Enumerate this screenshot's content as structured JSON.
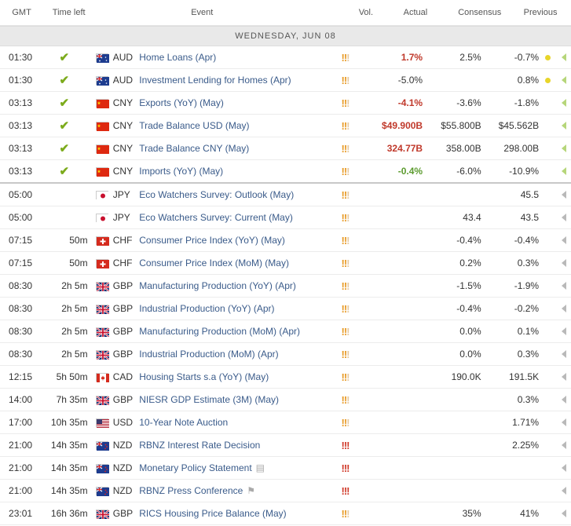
{
  "columns": {
    "gmt": "GMT",
    "time_left": "Time left",
    "event": "Event",
    "vol": "Vol.",
    "actual": "Actual",
    "consensus": "Consensus",
    "previous": "Previous"
  },
  "day_label": "WEDNESDAY, JUN 08",
  "colors": {
    "actual_negative": "#c0392b",
    "actual_positive": "#5c9b2f",
    "event_link": "#3a5b8a",
    "volatility": "#e89a25",
    "volatility_high": "#d03a2a",
    "check": "#7cab1c"
  },
  "rows": [
    {
      "gmt": "01:30",
      "time_left": "",
      "done": true,
      "flag": "au",
      "currency": "AUD",
      "event": "Home Loans (Apr)",
      "event_icon": "",
      "vol": 2,
      "actual": "1.7%",
      "actual_color": "red",
      "consensus": "2.5%",
      "previous": "-0.7%",
      "dot": true,
      "arrow": "green"
    },
    {
      "gmt": "01:30",
      "time_left": "",
      "done": true,
      "flag": "au",
      "currency": "AUD",
      "event": "Investment Lending for Homes (Apr)",
      "event_icon": "",
      "vol": 2,
      "actual": "-5.0%",
      "actual_color": "plain",
      "consensus": "",
      "previous": "0.8%",
      "dot": true,
      "arrow": "green"
    },
    {
      "gmt": "03:13",
      "time_left": "",
      "done": true,
      "flag": "cn",
      "currency": "CNY",
      "event": "Exports (YoY) (May)",
      "event_icon": "",
      "vol": 2,
      "actual": "-4.1%",
      "actual_color": "red",
      "consensus": "-3.6%",
      "previous": "-1.8%",
      "dot": false,
      "arrow": "green"
    },
    {
      "gmt": "03:13",
      "time_left": "",
      "done": true,
      "flag": "cn",
      "currency": "CNY",
      "event": "Trade Balance USD (May)",
      "event_icon": "",
      "vol": 2,
      "actual": "$49.900B",
      "actual_color": "red",
      "consensus": "$55.800B",
      "previous": "$45.562B",
      "dot": false,
      "arrow": "green"
    },
    {
      "gmt": "03:13",
      "time_left": "",
      "done": true,
      "flag": "cn",
      "currency": "CNY",
      "event": "Trade Balance CNY (May)",
      "event_icon": "",
      "vol": 2,
      "actual": "324.77B",
      "actual_color": "red",
      "consensus": "358.00B",
      "previous": "298.00B",
      "dot": false,
      "arrow": "green"
    },
    {
      "gmt": "03:13",
      "time_left": "",
      "done": true,
      "flag": "cn",
      "currency": "CNY",
      "event": "Imports (YoY) (May)",
      "event_icon": "",
      "vol": 2,
      "actual": "-0.4%",
      "actual_color": "green",
      "consensus": "-6.0%",
      "previous": "-10.9%",
      "dot": false,
      "arrow": "green",
      "sep": true
    },
    {
      "gmt": "05:00",
      "time_left": "",
      "done": false,
      "flag": "jp",
      "currency": "JPY",
      "event": "Eco Watchers Survey: Outlook (May)",
      "event_icon": "",
      "vol": 2,
      "actual": "",
      "actual_color": "plain",
      "consensus": "",
      "previous": "45.5",
      "dot": false,
      "arrow": "gray"
    },
    {
      "gmt": "05:00",
      "time_left": "",
      "done": false,
      "flag": "jp",
      "currency": "JPY",
      "event": "Eco Watchers Survey: Current (May)",
      "event_icon": "",
      "vol": 2,
      "actual": "",
      "actual_color": "plain",
      "consensus": "43.4",
      "previous": "43.5",
      "dot": false,
      "arrow": "gray"
    },
    {
      "gmt": "07:15",
      "time_left": "50m",
      "done": false,
      "flag": "ch",
      "currency": "CHF",
      "event": "Consumer Price Index (YoY) (May)",
      "event_icon": "",
      "vol": 2,
      "actual": "",
      "actual_color": "plain",
      "consensus": "-0.4%",
      "previous": "-0.4%",
      "dot": false,
      "arrow": "gray"
    },
    {
      "gmt": "07:15",
      "time_left": "50m",
      "done": false,
      "flag": "ch",
      "currency": "CHF",
      "event": "Consumer Price Index (MoM) (May)",
      "event_icon": "",
      "vol": 2,
      "actual": "",
      "actual_color": "plain",
      "consensus": "0.2%",
      "previous": "0.3%",
      "dot": false,
      "arrow": "gray"
    },
    {
      "gmt": "08:30",
      "time_left": "2h 5m",
      "done": false,
      "flag": "gb",
      "currency": "GBP",
      "event": "Manufacturing Production (YoY) (Apr)",
      "event_icon": "",
      "vol": 2,
      "actual": "",
      "actual_color": "plain",
      "consensus": "-1.5%",
      "previous": "-1.9%",
      "dot": false,
      "arrow": "gray"
    },
    {
      "gmt": "08:30",
      "time_left": "2h 5m",
      "done": false,
      "flag": "gb",
      "currency": "GBP",
      "event": "Industrial Production (YoY) (Apr)",
      "event_icon": "",
      "vol": 2,
      "actual": "",
      "actual_color": "plain",
      "consensus": "-0.4%",
      "previous": "-0.2%",
      "dot": false,
      "arrow": "gray"
    },
    {
      "gmt": "08:30",
      "time_left": "2h 5m",
      "done": false,
      "flag": "gb",
      "currency": "GBP",
      "event": "Manufacturing Production (MoM) (Apr)",
      "event_icon": "",
      "vol": 2,
      "actual": "",
      "actual_color": "plain",
      "consensus": "0.0%",
      "previous": "0.1%",
      "dot": false,
      "arrow": "gray"
    },
    {
      "gmt": "08:30",
      "time_left": "2h 5m",
      "done": false,
      "flag": "gb",
      "currency": "GBP",
      "event": "Industrial Production (MoM) (Apr)",
      "event_icon": "",
      "vol": 2,
      "actual": "",
      "actual_color": "plain",
      "consensus": "0.0%",
      "previous": "0.3%",
      "dot": false,
      "arrow": "gray"
    },
    {
      "gmt": "12:15",
      "time_left": "5h 50m",
      "done": false,
      "flag": "ca",
      "currency": "CAD",
      "event": "Housing Starts s.a (YoY) (May)",
      "event_icon": "",
      "vol": 2,
      "actual": "",
      "actual_color": "plain",
      "consensus": "190.0K",
      "previous": "191.5K",
      "dot": false,
      "arrow": "gray"
    },
    {
      "gmt": "14:00",
      "time_left": "7h 35m",
      "done": false,
      "flag": "gb",
      "currency": "GBP",
      "event": "NIESR GDP Estimate (3M) (May)",
      "event_icon": "",
      "vol": 2,
      "actual": "",
      "actual_color": "plain",
      "consensus": "",
      "previous": "0.3%",
      "dot": false,
      "arrow": "gray"
    },
    {
      "gmt": "17:00",
      "time_left": "10h 35m",
      "done": false,
      "flag": "us",
      "currency": "USD",
      "event": "10-Year Note Auction",
      "event_icon": "",
      "vol": 2,
      "actual": "",
      "actual_color": "plain",
      "consensus": "",
      "previous": "1.71%",
      "dot": false,
      "arrow": "gray"
    },
    {
      "gmt": "21:00",
      "time_left": "14h 35m",
      "done": false,
      "flag": "nz",
      "currency": "NZD",
      "event": "RBNZ Interest Rate Decision",
      "event_icon": "",
      "vol": 3,
      "actual": "",
      "actual_color": "plain",
      "consensus": "",
      "previous": "2.25%",
      "dot": false,
      "arrow": "gray"
    },
    {
      "gmt": "21:00",
      "time_left": "14h 35m",
      "done": false,
      "flag": "nz",
      "currency": "NZD",
      "event": "Monetary Policy Statement",
      "event_icon": "document",
      "vol": 3,
      "actual": "",
      "actual_color": "plain",
      "consensus": "",
      "previous": "",
      "dot": false,
      "arrow": "gray"
    },
    {
      "gmt": "21:00",
      "time_left": "14h 35m",
      "done": false,
      "flag": "nz",
      "currency": "NZD",
      "event": "RBNZ Press Conference",
      "event_icon": "flag",
      "vol": 3,
      "actual": "",
      "actual_color": "plain",
      "consensus": "",
      "previous": "",
      "dot": false,
      "arrow": "gray"
    },
    {
      "gmt": "23:01",
      "time_left": "16h 36m",
      "done": false,
      "flag": "gb",
      "currency": "GBP",
      "event": "RICS Housing Price Balance (May)",
      "event_icon": "",
      "vol": 2,
      "actual": "",
      "actual_color": "plain",
      "consensus": "35%",
      "previous": "41%",
      "dot": false,
      "arrow": "gray"
    }
  ]
}
